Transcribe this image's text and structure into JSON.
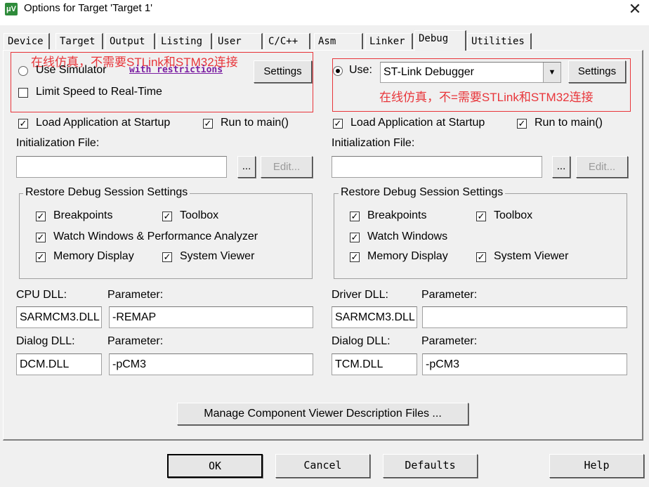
{
  "window": {
    "title": "Options for Target 'Target 1'",
    "close_glyph": "✕",
    "icon_text": "μV"
  },
  "tabs": [
    "Device",
    "Target",
    "Output",
    "Listing",
    "User",
    "C/C++",
    "Asm",
    "Linker",
    "Debug",
    "Utilities"
  ],
  "active_tab": "Debug",
  "left": {
    "annotation": "在线仿真，不需要STLink和STM32连接",
    "use_simulator": "Use Simulator",
    "restrictions_link": "with restrictions",
    "settings": "Settings",
    "limit_speed": "Limit Speed to Real-Time",
    "load_app": "Load Application at Startup",
    "run_to_main": "Run to main()",
    "init_file_label": "Initialization File:",
    "browse": "...",
    "edit": "Edit...",
    "restore_title": "Restore Debug Session Settings",
    "breakpoints": "Breakpoints",
    "toolbox": "Toolbox",
    "watch_windows": "Watch Windows & Performance Analyzer",
    "memory_display": "Memory Display",
    "system_viewer": "System Viewer",
    "cpu_dll_label": "CPU DLL:",
    "cpu_dll_value": "SARMCM3.DLL",
    "param_label": "Parameter:",
    "cpu_param_value": "-REMAP",
    "dialog_dll_label": "Dialog DLL:",
    "dialog_dll_value": "DCM.DLL",
    "dialog_param_value": "-pCM3"
  },
  "right": {
    "annotation": "在线仿真，不=需要STLink和STM32连接",
    "use_label": "Use:",
    "debugger_value": "ST-Link Debugger",
    "settings": "Settings",
    "load_app": "Load Application at Startup",
    "run_to_main": "Run to main()",
    "init_file_label": "Initialization File:",
    "browse": "...",
    "edit": "Edit...",
    "restore_title": "Restore Debug Session Settings",
    "breakpoints": "Breakpoints",
    "toolbox": "Toolbox",
    "watch_windows": "Watch Windows",
    "memory_display": "Memory Display",
    "system_viewer": "System Viewer",
    "driver_dll_label": "Driver DLL:",
    "driver_dll_value": "SARMCM3.DLL",
    "param_label": "Parameter:",
    "driver_param_value": "",
    "dialog_dll_label": "Dialog DLL:",
    "dialog_dll_value": "TCM.DLL",
    "dialog_param_value": "-pCM3"
  },
  "manage_button": "Manage Component Viewer Description Files ...",
  "footer": {
    "ok": "OK",
    "cancel": "Cancel",
    "defaults": "Defaults",
    "help": "Help"
  },
  "colors": {
    "annotation": "#e8353a",
    "link": "#7b1fa2"
  }
}
